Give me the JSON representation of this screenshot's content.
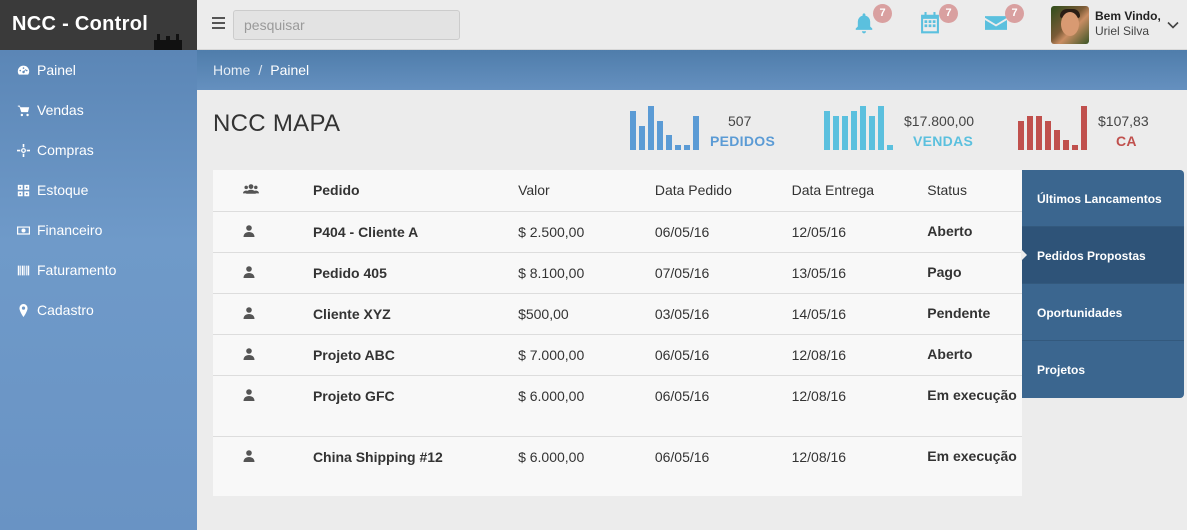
{
  "app": {
    "brand": "NCC - Control"
  },
  "sidebar": {
    "items": [
      {
        "label": "Painel",
        "icon": "dashboard-icon"
      },
      {
        "label": "Vendas",
        "icon": "cart-icon"
      },
      {
        "label": "Compras",
        "icon": "crosshair-icon"
      },
      {
        "label": "Estoque",
        "icon": "grid-icon"
      },
      {
        "label": "Financeiro",
        "icon": "money-icon"
      },
      {
        "label": "Faturamento",
        "icon": "barcode-icon"
      },
      {
        "label": "Cadastro",
        "icon": "map-marker-icon"
      }
    ]
  },
  "topbar": {
    "search_placeholder": "pesquisar",
    "notifications": [
      {
        "icon": "bell-icon",
        "count": "7"
      },
      {
        "icon": "calendar-icon",
        "count": "7"
      },
      {
        "icon": "envelope-icon",
        "count": "7"
      }
    ],
    "welcome": "Bem Vindo,",
    "user_name": "Uriel Silva"
  },
  "breadcrumb": {
    "home": "Home",
    "separator": "/",
    "current": "Painel"
  },
  "page": {
    "title": "NCC MAPA"
  },
  "stats": [
    {
      "value": "507",
      "label": "PEDIDOS",
      "color": "#5b9bd5",
      "bars": [
        8,
        5,
        9,
        6,
        3,
        1,
        1,
        7
      ]
    },
    {
      "value": "$17.800,00",
      "label": "VENDAS",
      "color": "#5bc0de",
      "bars": [
        8,
        7,
        7,
        8,
        9,
        7,
        9,
        1
      ]
    },
    {
      "value": "$107,83",
      "label": "CA",
      "color": "#c0504d",
      "bars": [
        6,
        7,
        7,
        6,
        4,
        2,
        1,
        9
      ]
    }
  ],
  "table": {
    "headers": [
      "",
      "Pedido",
      "Valor",
      "Data Pedido",
      "Data Entrega",
      "Status"
    ],
    "rows": [
      {
        "pedido": "P404 - Cliente A",
        "valor": "$ 2.500,00",
        "data_pedido": "06/05/16",
        "data_entrega": "12/05/16",
        "status": "Aberto"
      },
      {
        "pedido": "Pedido 405",
        "valor": "$ 8.100,00",
        "data_pedido": "07/05/16",
        "data_entrega": "13/05/16",
        "status": "Pago"
      },
      {
        "pedido": "Cliente XYZ",
        "valor": "$500,00",
        "data_pedido": "03/05/16",
        "data_entrega": "14/05/16",
        "status": "Pendente"
      },
      {
        "pedido": "Projeto ABC",
        "valor": "$ 7.000,00",
        "data_pedido": "06/05/16",
        "data_entrega": "12/08/16",
        "status": "Aberto"
      },
      {
        "pedido": "Projeto GFC",
        "valor": "$ 6.000,00",
        "data_pedido": "06/05/16",
        "data_entrega": "12/08/16",
        "status": "Em execução"
      },
      {
        "pedido": "China Shipping #12",
        "valor": "$ 6.000,00",
        "data_pedido": "06/05/16",
        "data_entrega": "12/08/16",
        "status": "Em execução"
      }
    ]
  },
  "right_tabs": [
    {
      "label": "Últimos Lancamentos",
      "active": false
    },
    {
      "label": "Pedidos Propostas",
      "active": true
    },
    {
      "label": "Oportunidades",
      "active": false
    },
    {
      "label": "Projetos",
      "active": false
    }
  ]
}
